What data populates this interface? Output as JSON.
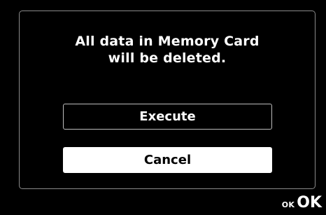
{
  "dialog": {
    "message_line1": "All data in Memory Card",
    "message_line2": "will be deleted.",
    "execute_label": "Execute",
    "cancel_label": "Cancel",
    "selected_option": "Cancel"
  },
  "footer": {
    "ok_icon_label": "OK",
    "ok_label": "OK"
  },
  "colors": {
    "background": "#000000",
    "text": "#ffffff",
    "frame_border": "#8a8a8a",
    "selected_button_bg": "#ffffff",
    "selected_button_text": "#000000"
  }
}
